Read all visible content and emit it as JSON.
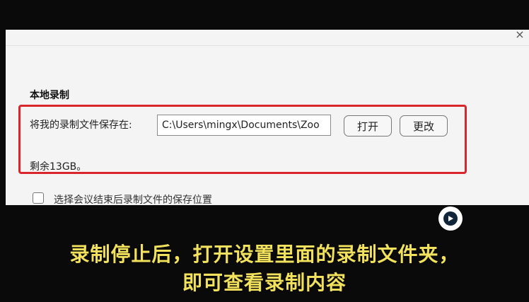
{
  "dialog": {
    "close_symbol": "×",
    "section_title": "本地录制",
    "save_label": "将我的录制文件保存在:",
    "path_value": "C:\\Users\\mingx\\Documents\\Zoo",
    "open_button": "打开",
    "change_button": "更改",
    "remaining": "剩余13GB。",
    "checkbox_label": "选择会议结束后录制文件的保存位置",
    "checkbox_checked": false,
    "highlight_color": "#d8262c"
  },
  "overlay": {
    "subtitle_line1": "录制停止后，打开设置里面的录制文件夹，",
    "subtitle_line2": "即可查看录制内容",
    "subtitle_color": "#f2e15c",
    "badge_icon": "play-logo-icon"
  }
}
